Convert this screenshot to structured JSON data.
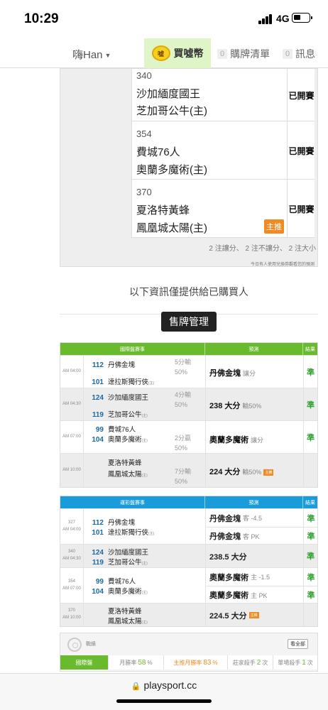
{
  "status_bar": {
    "time": "10:29",
    "network": "4G"
  },
  "nav": {
    "user": "嗨Han",
    "buy_label": "買噓幣",
    "coin_text": "噓",
    "cart_count": "0",
    "cart_label": "購牌清單",
    "msg_count": "0",
    "msg_label": "訊息"
  },
  "predictions": [
    {
      "no": "340",
      "away": "沙加緬度國王",
      "home": "芝加哥公牛(主)",
      "status": "已開賽",
      "tag": ""
    },
    {
      "no": "354",
      "away": "費城76人",
      "home": "奧蘭多魔術(主)",
      "status": "已開賽",
      "tag": ""
    },
    {
      "no": "370",
      "away": "夏洛特黃蜂",
      "home": "鳳凰城太陽(主)",
      "status": "已開賽",
      "tag": "主推"
    }
  ],
  "summary": "2 注讓分、 2 注不讓分、 2 注大小",
  "fineprint": "今日有人使用兌換券觀看您的預測",
  "info_line": "以下資訊僅提供給已購買人",
  "manage_button": "售牌管理",
  "intl_table": {
    "headers": [
      "國際盤賽事",
      "預測",
      "結果"
    ],
    "rows": [
      {
        "time": "AM 04:00",
        "no1": "112",
        "t1": "丹佛金塊",
        "no2": "101",
        "t2": "達拉斯獨行俠",
        "t2h": "(主)",
        "o1": "5分輸",
        "o2": "50%",
        "pred": "丹佛金塊",
        "pred_sub": "讓分",
        "hot": "",
        "res": "準"
      },
      {
        "time": "AM 04:30",
        "no1": "124",
        "t1": "沙加緬度國王",
        "no2": "119",
        "t2": "芝加哥公牛",
        "t2h": "(主)",
        "o1": "4分輸",
        "o2": "50%",
        "pred": "238 大分",
        "pred_sub": "輸50%",
        "hot": "",
        "res": "準"
      },
      {
        "time": "AM 07:00",
        "no1": "99",
        "t1": "費城76人",
        "no2": "104",
        "t2": "奧蘭多魔術",
        "t2h": "(主)",
        "o1": "2分贏",
        "o2": "50%",
        "pred": "奧蘭多魔術",
        "pred_sub": "讓分",
        "hot": "",
        "res": "準"
      },
      {
        "time": "AM 10:00",
        "no1": "",
        "t1": "夏洛特黃蜂",
        "no2": "",
        "t2": "鳳凰城太陽",
        "t2h": "(主)",
        "o1": "7分輸",
        "o2": "50%",
        "pred": "224 大分",
        "pred_sub": "輸50%",
        "hot": "主推",
        "res": ""
      }
    ]
  },
  "lottery_table": {
    "headers": [
      "運彩盤賽事",
      "預測",
      "結果"
    ],
    "rows": [
      {
        "no": "327",
        "time": "AM 04:00",
        "no1": "112",
        "t1": "丹佛金塊",
        "no2": "101",
        "t2": "達拉斯獨行俠",
        "t2h": "(主)",
        "preds": [
          {
            "v": "丹佛金塊",
            "sub": "客 -4.5",
            "res": "準"
          },
          {
            "v": "丹佛金塊",
            "sub": "客 PK",
            "res": "準"
          }
        ]
      },
      {
        "no": "340",
        "time": "AM 04:30",
        "no1": "124",
        "t1": "沙加緬度國王",
        "no2": "119",
        "t2": "芝加哥公牛",
        "t2h": "(主)",
        "preds": [
          {
            "v": "238.5 大分",
            "sub": "",
            "res": "準"
          }
        ]
      },
      {
        "no": "354",
        "time": "AM 07:00",
        "no1": "99",
        "t1": "費城76人",
        "no2": "104",
        "t2": "奧蘭多魔術",
        "t2h": "(主)",
        "preds": [
          {
            "v": "奧蘭多魔術",
            "sub": "主 -1.5",
            "res": "準"
          },
          {
            "v": "奧蘭多魔術",
            "sub": "主 PK",
            "res": "準"
          }
        ]
      },
      {
        "no": "370",
        "time": "AM 10:00",
        "no1": "",
        "t1": "夏洛特黃蜂",
        "no2": "",
        "t2": "鳳凰城太陽",
        "t2h": "(主)",
        "preds": [
          {
            "v": "224.5 大分",
            "sub": "",
            "res": "",
            "hot": "主推"
          }
        ]
      }
    ]
  },
  "record": {
    "title": "戰績",
    "view_all": "看全部",
    "tag": "國際盤",
    "month_rate_label": "月勝率",
    "month_rate": "58",
    "main_rate_label": "主推月勝率",
    "main_rate": "83",
    "streak_label": "莊家殺手",
    "streak": "2",
    "single_label": "單場殺手",
    "single": "1",
    "unit_pct": "%",
    "unit_times": "次"
  },
  "browser": {
    "url": "playsport.cc"
  }
}
